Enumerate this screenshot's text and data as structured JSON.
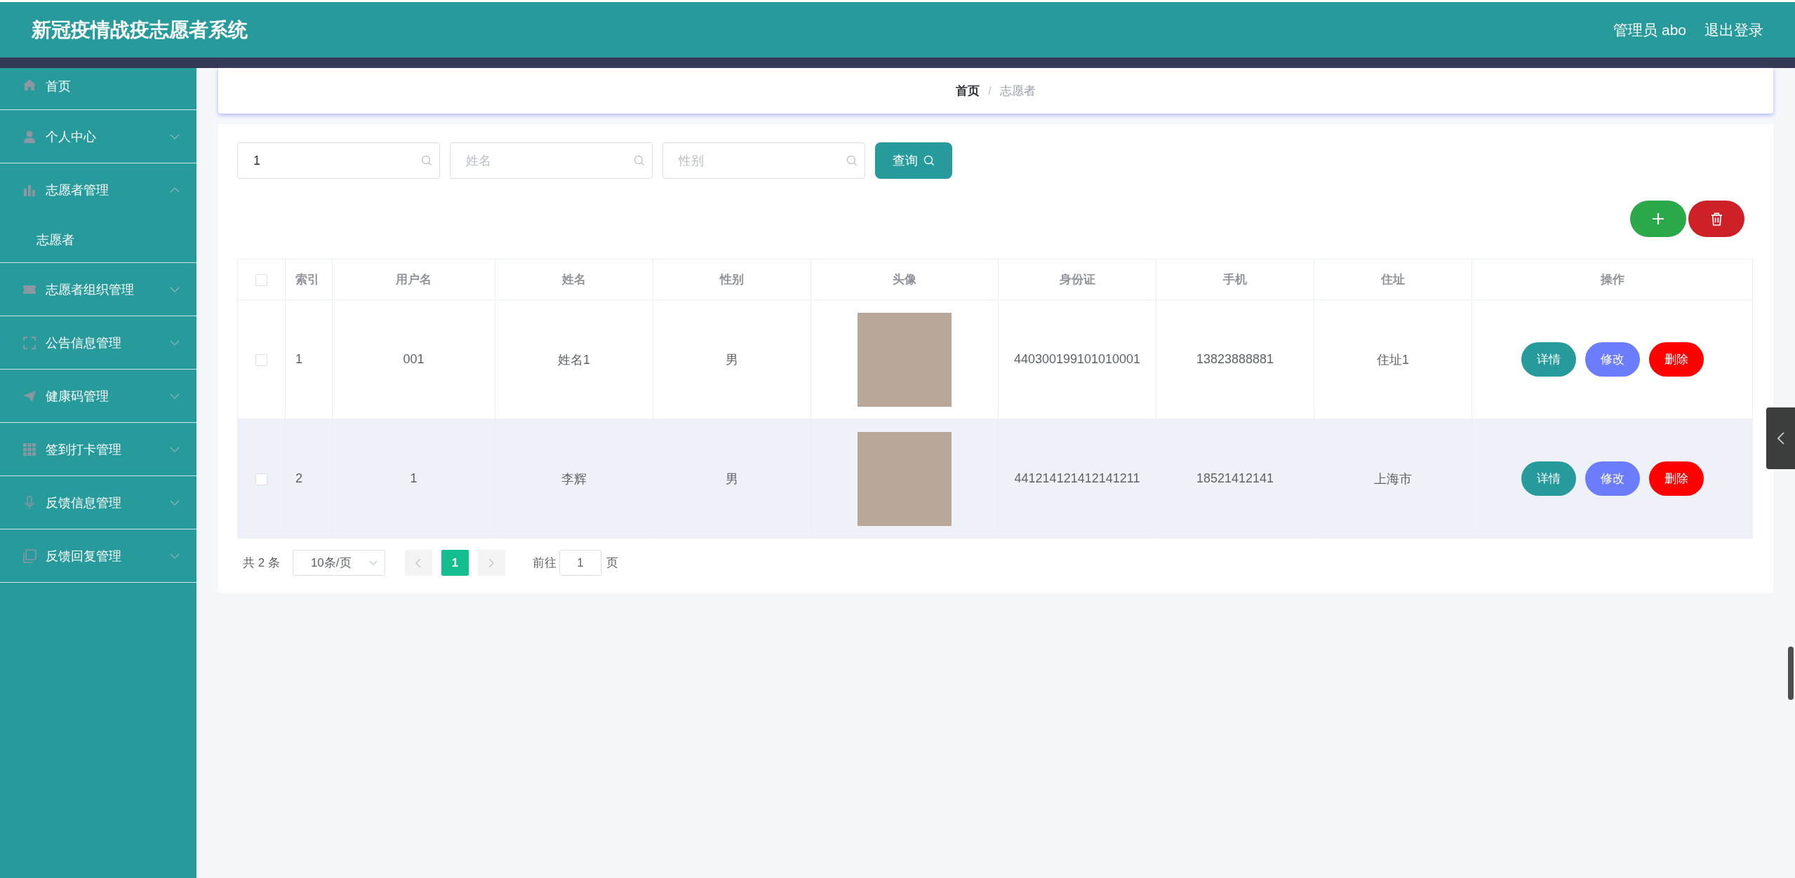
{
  "header": {
    "title": "新冠疫情战疫志愿者系统",
    "user": "管理员 abo",
    "logout": "退出登录"
  },
  "sidebar": {
    "items": [
      {
        "label": "首页",
        "kind": "link"
      },
      {
        "label": "个人中心",
        "kind": "menu",
        "expanded": false
      },
      {
        "label": "志愿者管理",
        "kind": "menu",
        "expanded": true,
        "children": [
          {
            "label": "志愿者"
          }
        ]
      },
      {
        "label": "志愿者组织管理",
        "kind": "menu",
        "expanded": false
      },
      {
        "label": "公告信息管理",
        "kind": "menu",
        "expanded": false
      },
      {
        "label": "健康码管理",
        "kind": "menu",
        "expanded": false
      },
      {
        "label": "签到打卡管理",
        "kind": "menu",
        "expanded": false
      },
      {
        "label": "反馈信息管理",
        "kind": "menu",
        "expanded": false
      },
      {
        "label": "反馈回复管理",
        "kind": "menu",
        "expanded": false
      }
    ]
  },
  "breadcrumb": {
    "items": [
      "首页",
      "志愿者"
    ],
    "separator": "/"
  },
  "search": {
    "fields": [
      {
        "value": "1"
      },
      {
        "placeholder": "姓名"
      },
      {
        "placeholder": "性别"
      }
    ],
    "button": "查询"
  },
  "table": {
    "all_checked": false,
    "columns": [
      "索引",
      "用户名",
      "姓名",
      "性别",
      "头像",
      "身份证",
      "手机",
      "住址",
      "操作"
    ],
    "rows": [
      {
        "checked": false,
        "hovered": false,
        "index": "1",
        "username": "001",
        "name": "姓名1",
        "gender": "男",
        "id_card": "440300199101010001",
        "phone": "13823888881",
        "address": "住址1",
        "actions": [
          {
            "kind": "detail",
            "label": "详情"
          },
          {
            "kind": "edit",
            "label": "修改"
          },
          {
            "kind": "delete",
            "label": "删除"
          }
        ]
      },
      {
        "checked": false,
        "hovered": true,
        "index": "2",
        "username": "1",
        "name": "李辉",
        "gender": "男",
        "id_card": "441214121412141211",
        "phone": "18521412141",
        "address": "上海市",
        "actions": [
          {
            "kind": "detail",
            "label": "详情"
          },
          {
            "kind": "edit",
            "label": "修改"
          },
          {
            "kind": "delete",
            "label": "删除"
          }
        ]
      }
    ]
  },
  "pagination": {
    "total": "共 2 条",
    "page_size": "10条/页",
    "pages": [
      {
        "label": "1",
        "selected": true
      }
    ],
    "goto_label": "前往",
    "goto_value": "1",
    "goto_suffix": "页"
  }
}
